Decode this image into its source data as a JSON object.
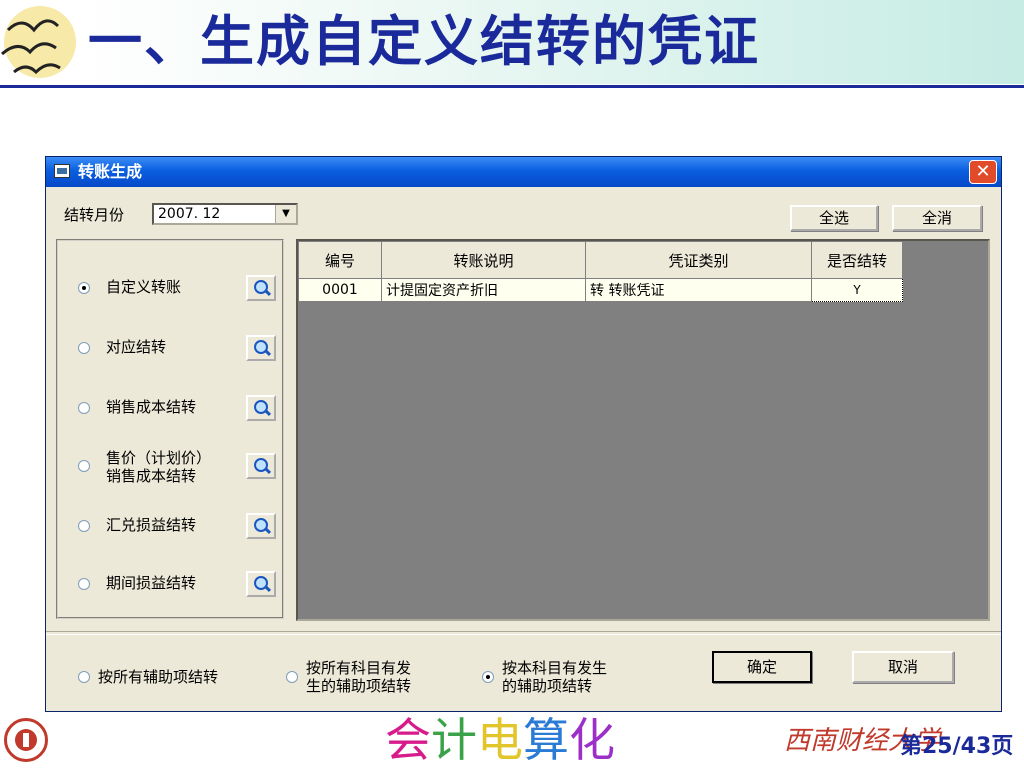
{
  "slide": {
    "title": "一、生成自定义结转的凭证",
    "footer_word": [
      "会",
      "计",
      "电",
      "算",
      "化"
    ],
    "school_name": "西南财经大学",
    "page_number": "第25/43页"
  },
  "window": {
    "title": "转账生成",
    "close_symbol": "✕",
    "month_label": "结转月份",
    "month_value": "2007. 12",
    "dropdown_symbol": "▼",
    "select_all": "全选",
    "deselect_all": "全消",
    "transfer_types": [
      {
        "label": "自定义转账",
        "checked": true
      },
      {
        "label": "对应结转",
        "checked": false
      },
      {
        "label": "销售成本结转",
        "checked": false
      },
      {
        "label": "售价（计划价）销售成本结转",
        "line1": "售价（计划价）",
        "line2": "销售成本结转",
        "checked": false
      },
      {
        "label": "汇兑损益结转",
        "checked": false
      },
      {
        "label": "期间损益结转",
        "checked": false
      }
    ],
    "grid": {
      "columns": [
        "编号",
        "转账说明",
        "凭证类别",
        "是否结转"
      ],
      "rows": [
        [
          "0001",
          "计提固定资产折旧",
          "转 转账凭证",
          "Y"
        ]
      ]
    },
    "aux_options": [
      {
        "line1": "按所有辅助项结转",
        "line2": "",
        "checked": false
      },
      {
        "line1": "按所有科目有发",
        "line2": "生的辅助项结转",
        "checked": false
      },
      {
        "line1": "按本科目有发生",
        "line2": "的辅助项结转",
        "checked": true
      }
    ],
    "ok_label": "确定",
    "cancel_label": "取消"
  },
  "colors": {
    "title_blue": "#1b2a9a",
    "titlebar_blue": "#0a5fe0",
    "window_bg": "#ece9d8",
    "grid_bg": "#808080",
    "school_red": "#c0392b"
  }
}
